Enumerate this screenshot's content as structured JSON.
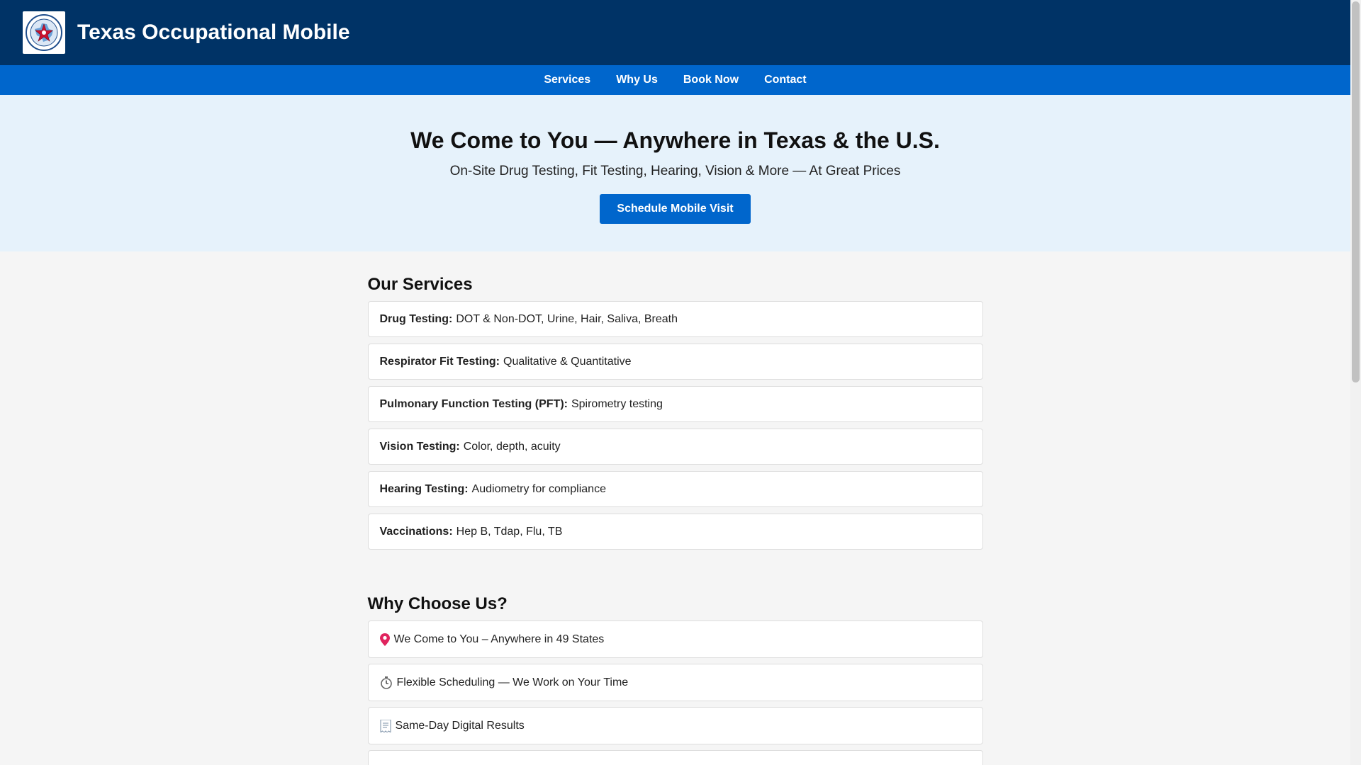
{
  "header": {
    "brand": "Texas Occupational Mobile",
    "logo_icon": "texas-star-seal-icon"
  },
  "nav": {
    "items": [
      {
        "label": "Services"
      },
      {
        "label": "Why Us"
      },
      {
        "label": "Book Now"
      },
      {
        "label": "Contact"
      }
    ]
  },
  "hero": {
    "title": "We Come to You — Anywhere in Texas & the U.S.",
    "subtitle": "On-Site Drug Testing, Fit Testing, Hearing, Vision & More — At Great Prices",
    "cta_label": "Schedule Mobile Visit"
  },
  "services": {
    "title": "Our Services",
    "items": [
      {
        "name": "Drug Testing:",
        "desc": "DOT & Non-DOT, Urine, Hair, Saliva, Breath"
      },
      {
        "name": "Respirator Fit Testing:",
        "desc": "Qualitative & Quantitative"
      },
      {
        "name": "Pulmonary Function Testing (PFT):",
        "desc": "Spirometry testing"
      },
      {
        "name": "Vision Testing:",
        "desc": "Color, depth, acuity"
      },
      {
        "name": "Hearing Testing:",
        "desc": "Audiometry for compliance"
      },
      {
        "name": "Vaccinations:",
        "desc": "Hep B, Tdap, Flu, TB"
      }
    ]
  },
  "why": {
    "title": "Why Choose Us?",
    "items": [
      {
        "icon": "pin-icon",
        "text": "We Come to You – Anywhere in 49 States"
      },
      {
        "icon": "stopwatch-icon",
        "text": "Flexible Scheduling — We Work on Your Time"
      },
      {
        "icon": "receipt-icon",
        "text": "Same-Day Digital Results"
      }
    ]
  },
  "colors": {
    "header_bg": "#003366",
    "nav_bg": "#0066cc",
    "hero_bg": "#e6f2fb",
    "accent": "#0066cc"
  }
}
